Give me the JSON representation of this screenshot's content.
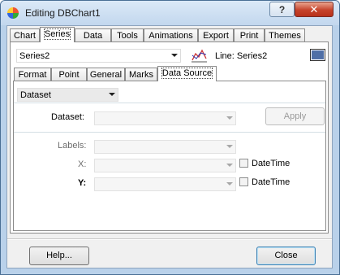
{
  "window": {
    "title": "Editing DBChart1",
    "help_glyph": "?",
    "close_glyph": "✕"
  },
  "main_tabs": [
    "Chart",
    "Series",
    "Data",
    "Tools",
    "Animations",
    "Export",
    "Print",
    "Themes"
  ],
  "series_selector": {
    "value": "Series2"
  },
  "series_type_label": "Line: Series2",
  "series_color": "#4f6fa6",
  "sub_tabs": [
    "Format",
    "Point",
    "General",
    "Marks",
    "Data Source"
  ],
  "datasource": {
    "source_type": "Dataset",
    "dataset_label": "Dataset:",
    "apply_label": "Apply",
    "labels_label": "Labels:",
    "x_label": "X:",
    "y_label": "Y:",
    "datetime_label": "DateTime"
  },
  "footer": {
    "help_button": "Help...",
    "close_button": "Close"
  }
}
